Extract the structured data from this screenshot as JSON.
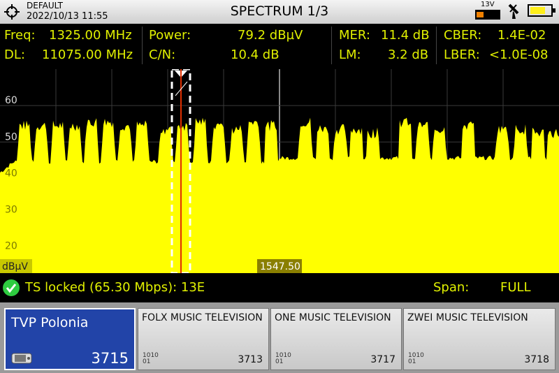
{
  "header": {
    "preset": "DEFAULT",
    "datetime": "2022/10/13 11:55",
    "title": "SPECTRUM 1/3",
    "lnb_voltage": "13V",
    "battery_level": 0.75
  },
  "measurements": {
    "freq": {
      "label": "Freq:",
      "value": "1325.00 MHz"
    },
    "dl": {
      "label": "DL:",
      "value": "11075.00 MHz"
    },
    "power": {
      "label": "Power:",
      "value": "79.2 dBµV"
    },
    "cn": {
      "label": "C/N:",
      "value": "10.4 dB"
    },
    "mer": {
      "label": "MER:",
      "value": "11.4 dB"
    },
    "lm": {
      "label": "LM:",
      "value": "3.2 dB"
    },
    "cber": {
      "label": "CBER:",
      "value": "1.4E-02"
    },
    "lber": {
      "label": "LBER:",
      "value": "<1.0E-08"
    }
  },
  "chart_data": {
    "type": "area",
    "ylabel": "dBµV",
    "yticks": [
      60,
      50,
      40,
      30,
      20
    ],
    "ylim": [
      14,
      70
    ],
    "center_frequency_label": "1547.50",
    "marker_frequency_mhz": 1325.0,
    "span": "FULL",
    "noise_floor_db": [
      41,
      44,
      45
    ],
    "channels": [
      {
        "center": 35,
        "level": 55
      },
      {
        "center": 59,
        "level": 55
      },
      {
        "center": 83,
        "level": 55
      },
      {
        "center": 107,
        "level": 55
      },
      {
        "center": 131,
        "level": 56
      },
      {
        "center": 155,
        "level": 56
      },
      {
        "center": 179,
        "level": 55
      },
      {
        "center": 203,
        "level": 55
      },
      {
        "center": 237,
        "level": 54
      },
      {
        "center": 261,
        "level": 55
      },
      {
        "center": 287,
        "level": 56
      },
      {
        "center": 313,
        "level": 55
      },
      {
        "center": 339,
        "level": 54
      },
      {
        "center": 363,
        "level": 56
      },
      {
        "center": 388,
        "level": 55
      },
      {
        "center": 437,
        "level": 56
      },
      {
        "center": 462,
        "level": 54
      },
      {
        "center": 487,
        "level": 54
      },
      {
        "center": 510,
        "level": 54
      },
      {
        "center": 534,
        "level": 53
      },
      {
        "center": 580,
        "level": 56
      },
      {
        "center": 605,
        "level": 55
      },
      {
        "center": 629,
        "level": 54
      },
      {
        "center": 670,
        "level": 55
      },
      {
        "center": 719,
        "level": 54
      },
      {
        "center": 745,
        "level": 54
      },
      {
        "center": 770,
        "level": 53
      },
      {
        "center": 792,
        "level": 53
      }
    ],
    "colors": {
      "trace": "#ffff00",
      "marker": "#e03000",
      "grid": "#3a3a3a"
    }
  },
  "status": {
    "ts_text": "TS locked (65.30 Mbps): 13E",
    "span_label": "Span:",
    "span_value": "FULL",
    "ok_color": "#2ecc40"
  },
  "services": [
    {
      "name": "TVP Polonia",
      "sid": "3715",
      "selected": true,
      "icon": "tv-icon"
    },
    {
      "name": "FOLX MUSIC TELEVISION",
      "sid": "3713",
      "selected": false,
      "icon": "data-icon"
    },
    {
      "name": "ONE MUSIC TELEVISION",
      "sid": "3717",
      "selected": false,
      "icon": "data-icon"
    },
    {
      "name": "ZWEI MUSIC TELEVISION",
      "sid": "3718",
      "selected": false,
      "icon": "data-icon"
    }
  ],
  "data_icon_text": [
    "1010",
    "01"
  ]
}
